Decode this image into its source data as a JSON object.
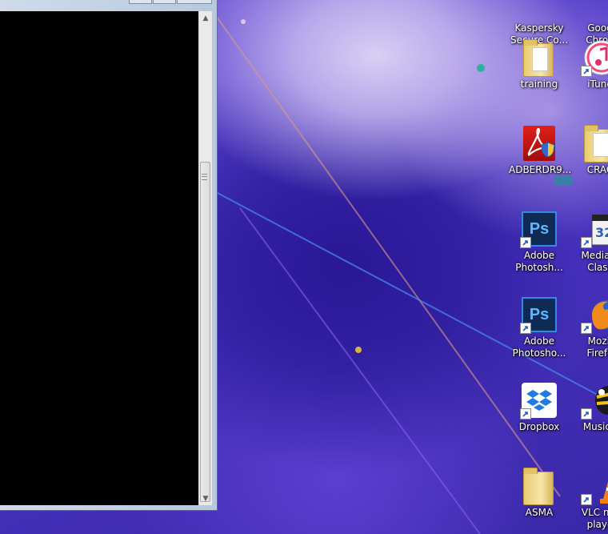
{
  "console_window": {
    "scrollbar": {
      "up_arrow": "▲",
      "down_arrow": "▼"
    }
  },
  "desktop_icons": {
    "column1": [
      {
        "label": "Kaspersky\nSecure Co...",
        "icon": "kaspersky-icon"
      },
      {
        "label": "training",
        "icon": "folder-icon"
      },
      {
        "label": "ADBERDR9...",
        "icon": "adobe-reader-icon"
      },
      {
        "label": "Adobe\nPhotosh...",
        "icon": "photoshop-icon"
      },
      {
        "label": "Adobe\nPhotosho...",
        "icon": "photoshop-icon"
      },
      {
        "label": "Dropbox",
        "icon": "dropbox-icon"
      },
      {
        "label": "ASMA",
        "icon": "folder-icon"
      }
    ],
    "column2": [
      {
        "label": "Goog\nChron",
        "icon": "chrome-icon"
      },
      {
        "label": "iTune",
        "icon": "itunes-icon"
      },
      {
        "label": "CRAC",
        "icon": "folder-icon"
      },
      {
        "label": "Media P\nClass",
        "icon": "media-player-classic-icon"
      },
      {
        "label": "Mozil\nFirefo",
        "icon": "firefox-icon"
      },
      {
        "label": "MusicB",
        "icon": "musicbee-icon"
      },
      {
        "label": "VLC me\nplaye",
        "icon": "vlc-icon"
      }
    ]
  },
  "colors": {
    "console_bg": "#000000",
    "wallpaper_primary": "#4a33c2",
    "icon_label": "#ffffff"
  }
}
